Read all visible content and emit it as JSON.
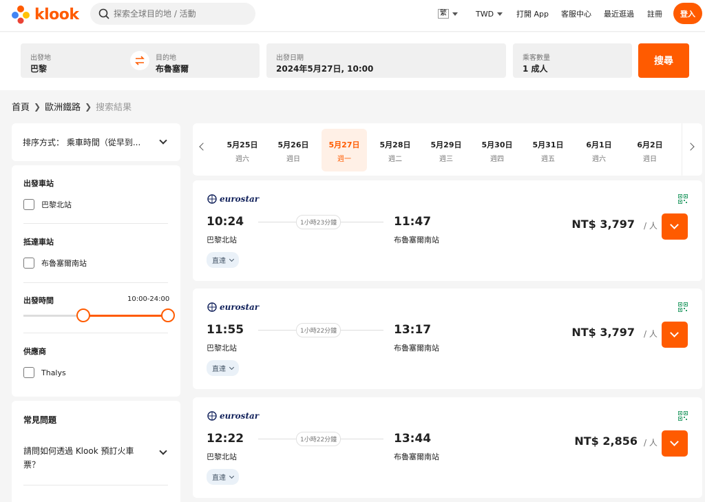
{
  "header": {
    "logo_text": "klook",
    "search_placeholder": "探索全球目的地 / 活動",
    "lang": "繁",
    "currency": "TWD",
    "open_app": "打開 App",
    "service": "客服中心",
    "recent": "最近逛過",
    "register": "註冊",
    "login": "登入"
  },
  "search_form": {
    "from_label": "出發地",
    "from_value": "巴黎",
    "to_label": "目的地",
    "to_value": "布魯塞爾",
    "date_label": "出發日期",
    "date_value": "2024年5月27日, 10:00",
    "pax_label": "乘客數量",
    "pax_value": "1 成人",
    "search_button": "搜尋"
  },
  "breadcrumb": [
    "首頁",
    "歐洲鐵路",
    "搜索結果"
  ],
  "sidebar": {
    "sort_text": "排序方式： 乘車時間（從早到...",
    "departure_station_title": "出發車站",
    "departure_station_option": "巴黎北站",
    "arrival_station_title": "抵達車站",
    "arrival_station_option": "布魯塞爾南站",
    "departure_time_title": "出發時間",
    "departure_time_range": "10:00-24:00",
    "departure_time_range_start": 10,
    "departure_time_range_end": 24,
    "supplier_title": "供應商",
    "supplier_option": "Thalys",
    "faq_title": "常見問題",
    "faq_q1": "請問如何透過 Klook 預訂火車票？"
  },
  "dates": [
    {
      "date": "5月25日",
      "weekday": "週六"
    },
    {
      "date": "5月26日",
      "weekday": "週日"
    },
    {
      "date": "5月27日",
      "weekday": "週一",
      "active": true
    },
    {
      "date": "5月28日",
      "weekday": "週二"
    },
    {
      "date": "5月29日",
      "weekday": "週三"
    },
    {
      "date": "5月30日",
      "weekday": "週四"
    },
    {
      "date": "5月31日",
      "weekday": "週五"
    },
    {
      "date": "6月1日",
      "weekday": "週六"
    },
    {
      "date": "6月2日",
      "weekday": "週日"
    }
  ],
  "trains": [
    {
      "brand": "eurostar",
      "dep": "10:24",
      "arr": "11:47",
      "duration": "1小時23分鐘",
      "dep_station": "巴黎北站",
      "arr_station": "布魯塞爾南站",
      "tag": "直達",
      "price": "NT$ 3,797",
      "per": "/ 人"
    },
    {
      "brand": "eurostar",
      "dep": "11:55",
      "arr": "13:17",
      "duration": "1小時22分鐘",
      "dep_station": "巴黎北站",
      "arr_station": "布魯塞爾南站",
      "tag": "直達",
      "price": "NT$ 3,797",
      "per": "/ 人"
    },
    {
      "brand": "eurostar",
      "dep": "12:22",
      "arr": "13:44",
      "duration": "1小時22分鐘",
      "dep_station": "巴黎北站",
      "arr_station": "布魯塞爾南站",
      "tag": "直達",
      "price": "NT$ 2,856",
      "per": "/ 人"
    }
  ],
  "colors": {
    "brand": "#ff5b00",
    "accent_bg": "#fff0e6",
    "tag_bg": "#eaf1f8"
  }
}
